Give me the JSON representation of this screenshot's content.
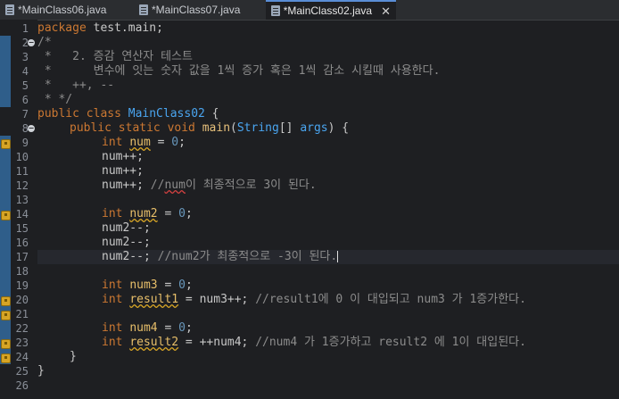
{
  "tabs": [
    {
      "label": "*MainClass06.java",
      "active": false
    },
    {
      "label": "*MainClass07.java",
      "active": false
    },
    {
      "label": "*MainClass02.java",
      "active": true
    }
  ],
  "editor": {
    "line_numbers": [
      "1",
      "2",
      "3",
      "4",
      "5",
      "6",
      "7",
      "8",
      "9",
      "10",
      "11",
      "12",
      "13",
      "14",
      "15",
      "16",
      "17",
      "18",
      "19",
      "20",
      "21",
      "22",
      "23",
      "24",
      "25",
      "26"
    ],
    "code": {
      "l1_kw": "package",
      "l1_rest": " test.main;",
      "l2": "/*",
      "l3": " *   2. 증감 연산자 테스트",
      "l4": " *      변수에 잇는 숫자 값을 1씩 증가 혹은 1씩 감소 시킬때 사용한다.",
      "l5": " *   ++, --",
      "l6": " * */",
      "l7_kw": "public class ",
      "l7_cls": "MainClass02",
      "l7_rest": " {",
      "l8_kw": "public static void ",
      "l8_fn": "main",
      "l8_p1": "(",
      "l8_type": "String",
      "l8_p2": "[] ",
      "l8_arg": "args",
      "l8_p3": ") {",
      "l9_kw": "int ",
      "l9_var": "num",
      "l9_eq": " = ",
      "l9_num": "0",
      "l9_end": ";",
      "l10": "num++;",
      "l11": "num++;",
      "l12_code": "num++; ",
      "l12_c1": "//",
      "l12_csq": "num",
      "l12_c2": "이 최종적으로 3이 된다.",
      "l14_kw": "int ",
      "l14_var": "num2",
      "l14_eq": " = ",
      "l14_num": "0",
      "l14_end": ";",
      "l15": "num2--;",
      "l16": "num2--;",
      "l17_code": "num2--; ",
      "l17_c": "//num2가 최종적으로 -3이 된다.",
      "l19_kw": "int ",
      "l19_var": "num3",
      "l19_eq": " = ",
      "l19_num": "0",
      "l19_end": ";",
      "l20_kw": "int ",
      "l20_var": "result1",
      "l20_code": " = num3++; ",
      "l20_c": "//result1에 0 이 대입되고 num3 가 1증가한다.",
      "l22_kw": "int ",
      "l22_var": "num4",
      "l22_eq": " = ",
      "l22_num": "0",
      "l22_end": ";",
      "l23_kw": "int ",
      "l23_var": "result2",
      "l23_code": " = ++num4; ",
      "l23_c": "//num4 가 1증가하고 result2 에 1이 대입된다.",
      "l24": "}",
      "l25": "}"
    }
  },
  "colors": {
    "keyword": "#cc7832",
    "class": "#4aa5f0",
    "number": "#6897bb",
    "comment": "#8c8c8c",
    "warning": "#d6a425"
  }
}
